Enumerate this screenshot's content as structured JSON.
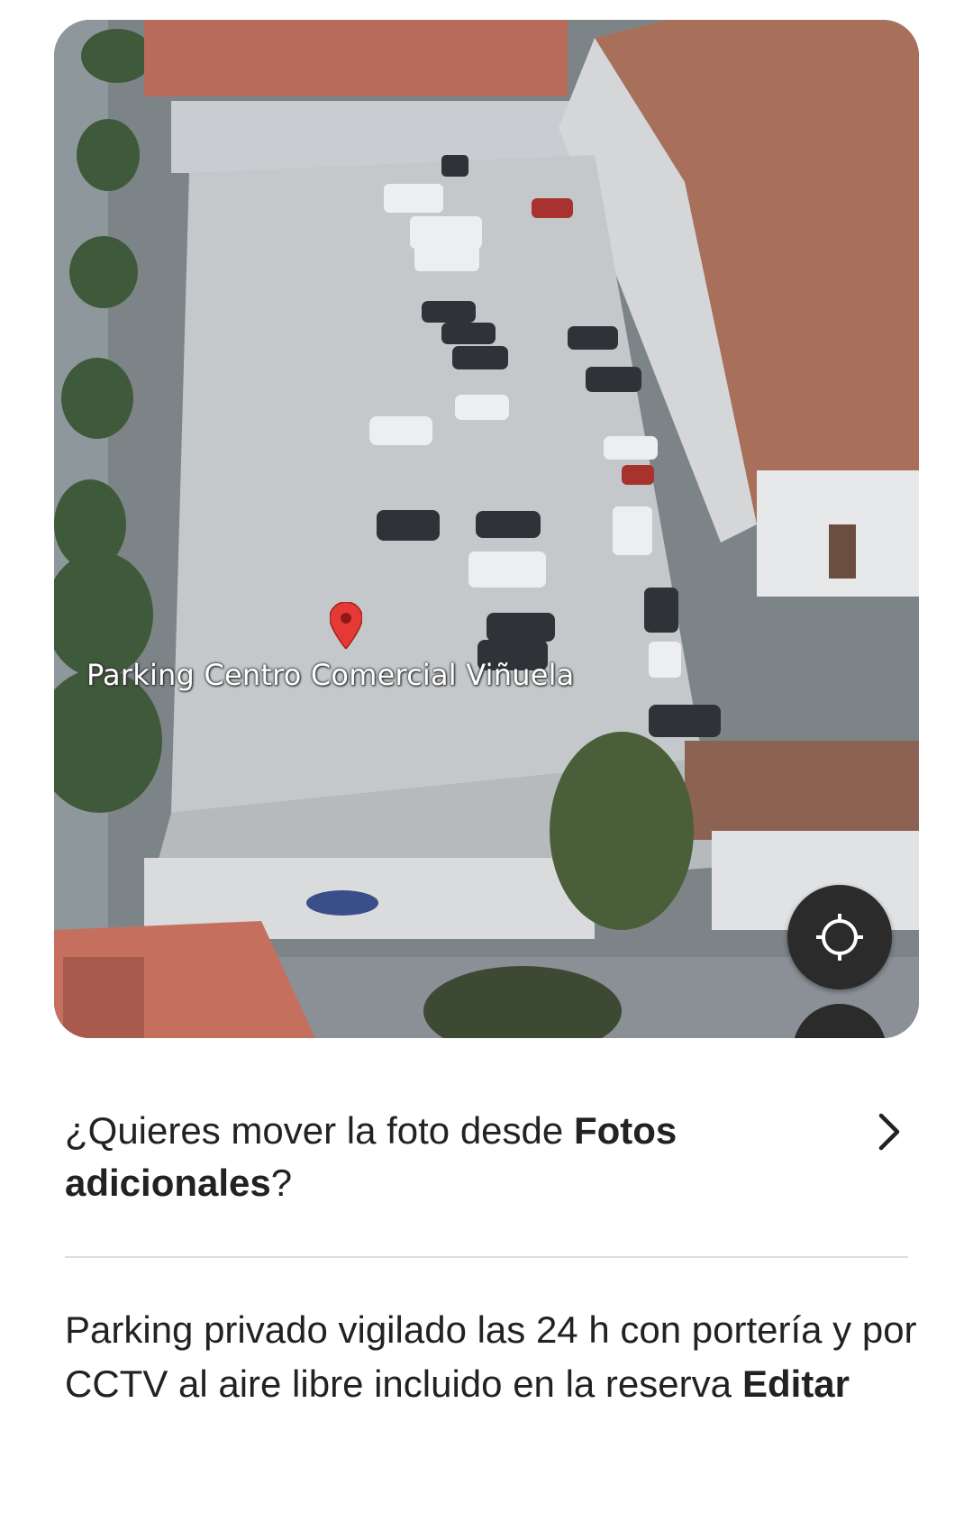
{
  "map": {
    "place_label": "Parking Centro Comercial Viñuela",
    "pin_icon": "map-pin-icon",
    "locate_icon": "crosshair-icon",
    "pin_color": "#e53935",
    "button_color": "#2b2b2b"
  },
  "move_prompt": {
    "text_prefix": "¿Quieres mover la foto desde ",
    "text_bold": "Fotos adicionales",
    "text_suffix": "?",
    "chevron_icon": "chevron-right-icon"
  },
  "parking_description": {
    "text": "Parking privado vigilado las 24 h con portería y por CCTV al aire libre incluido en la reserva",
    "edit_label": "Editar"
  }
}
